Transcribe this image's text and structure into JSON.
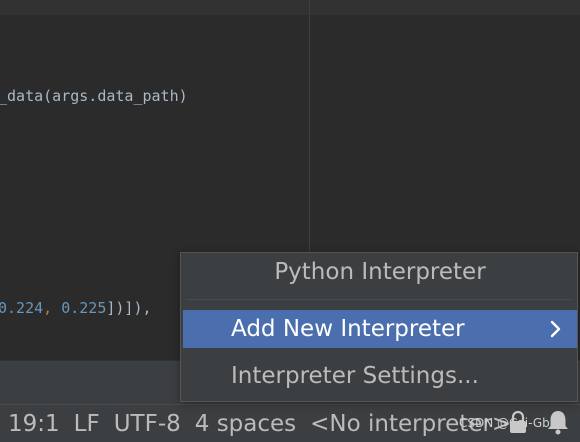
{
  "editor": {
    "line1": "_data(args.data_path)",
    "line2_num1": "0.224",
    "line2_sep": ", ",
    "line2_num2": "0.225",
    "line2_tail": "])]),"
  },
  "popup": {
    "title": "Python Interpreter",
    "items": [
      {
        "label": "Add New Interpreter",
        "has_submenu": true,
        "selected": true
      },
      {
        "label": "Interpreter Settings..."
      }
    ]
  },
  "status_bar": {
    "position": "19:1",
    "line_ending": "LF",
    "encoding": "UTF-8",
    "indent": "4 spaces",
    "interpreter": "<No interpreter>",
    "icons": [
      "lock-icon",
      "bell-icon"
    ]
  },
  "watermark": "CSDN @Cai-Gbro",
  "colors": {
    "selection": "#4b6eaf",
    "number": "#6897bb",
    "panel": "#3c3f41"
  }
}
